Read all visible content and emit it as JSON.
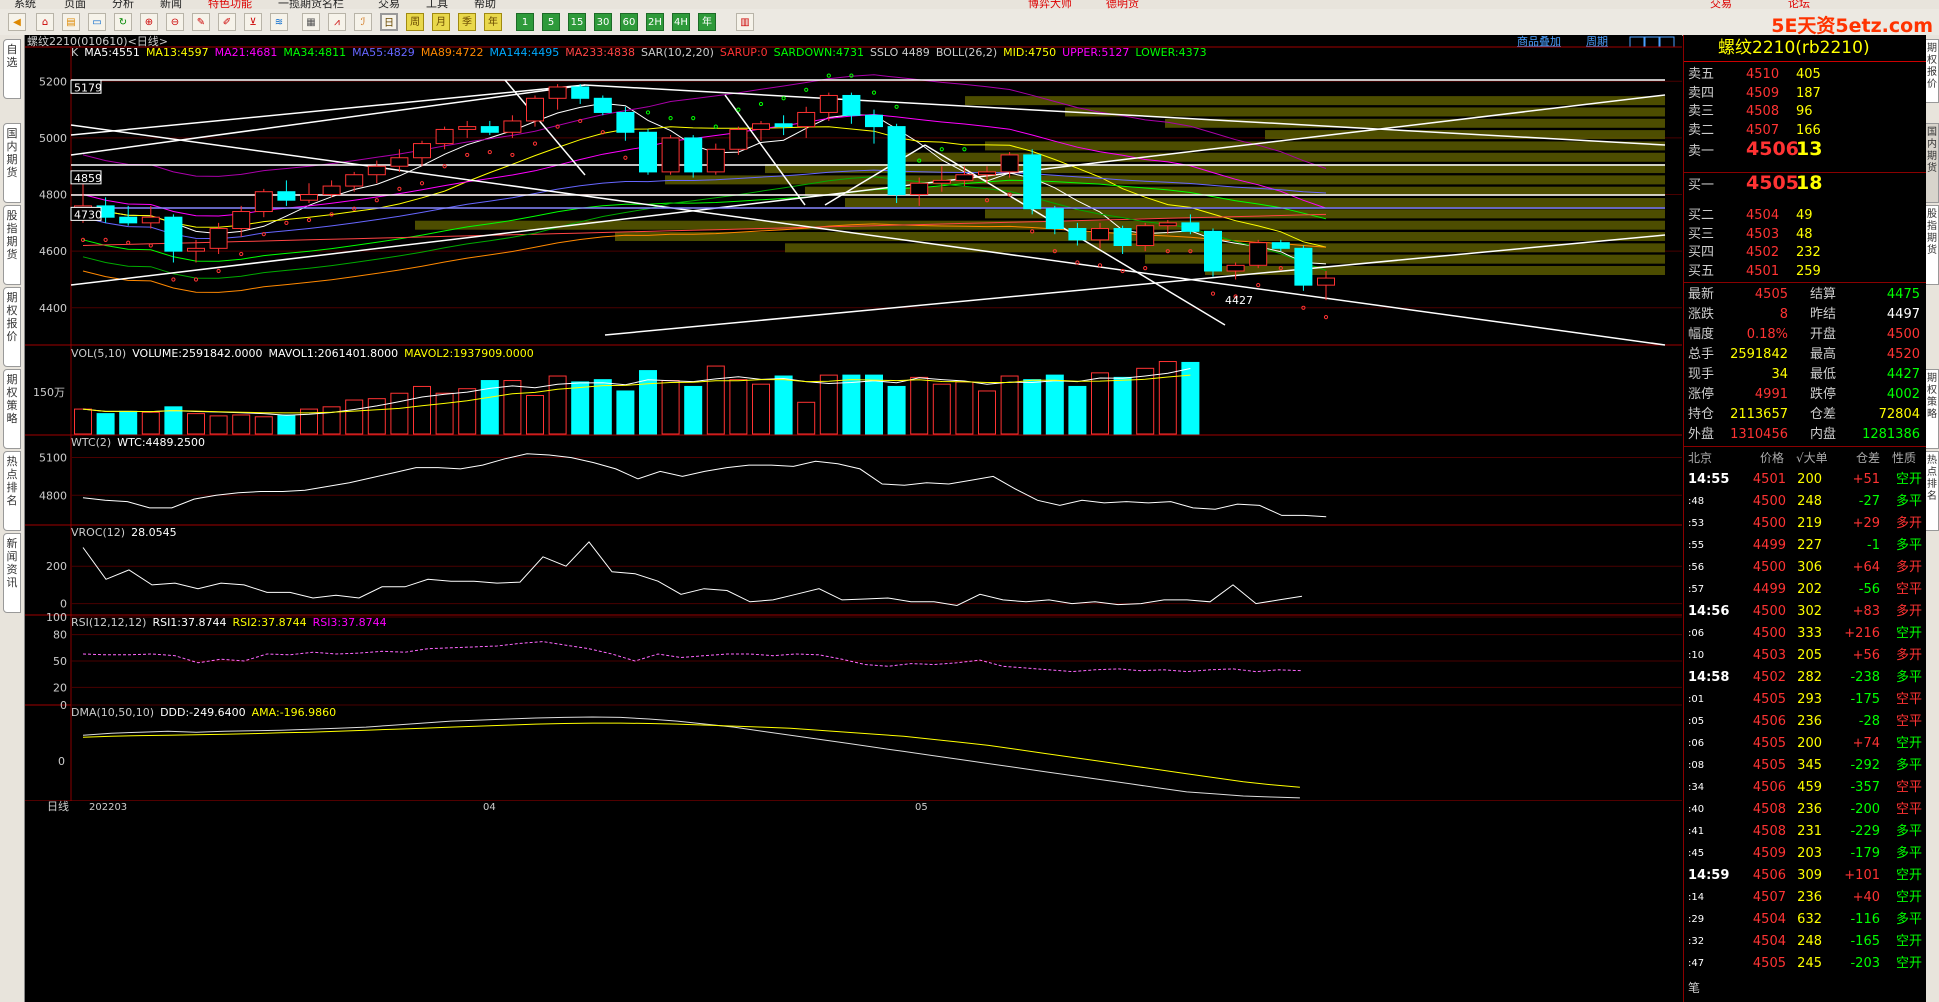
{
  "menu": [
    {
      "label": "系统"
    },
    {
      "label": "页面"
    },
    {
      "label": "分析"
    },
    {
      "label": "新闻"
    },
    {
      "label": "特色功能",
      "red": true
    },
    {
      "label": "一揽期货名栏"
    },
    {
      "label": "交易"
    },
    {
      "label": "工具"
    },
    {
      "label": "帮助"
    },
    {
      "label": "博弈大师",
      "red": true
    },
    {
      "label": "德明货",
      "red": true
    }
  ],
  "menu_right": [
    "交易",
    "论坛"
  ],
  "brand": "5E天资5etz.com",
  "toolbar": {
    "period_buttons": [
      "周",
      "月",
      "季",
      "年",
      "1",
      "5",
      "15",
      "30",
      "60",
      "2H",
      "4H",
      "年"
    ]
  },
  "left_tabs": [
    "自选",
    "国内期货",
    "股指期货",
    "期权报价",
    "期权策略",
    "热点排名",
    "新闻资讯"
  ],
  "right_tabs": [
    "期权报价",
    "国内期货",
    "股指期货",
    "期权策略",
    "热点排名"
  ],
  "chart": {
    "header": "螺纹2210(010610)<日线>",
    "overlay_btn": "商品叠加",
    "period_btn": "周期",
    "main_indicators": [
      {
        "t": "K",
        "c": "#cccccc"
      },
      {
        "t": "MA5:4551",
        "c": "#ffffff"
      },
      {
        "t": "MA13:4597",
        "c": "#ffff00"
      },
      {
        "t": "MA21:4681",
        "c": "#ff00ff"
      },
      {
        "t": "MA34:4811",
        "c": "#00ff00"
      },
      {
        "t": "MA55:4829",
        "c": "#6666ff"
      },
      {
        "t": "MA89:4722",
        "c": "#ff8800"
      },
      {
        "t": "MA144:4495",
        "c": "#00aaff"
      },
      {
        "t": "MA233:4838",
        "c": "#ff4444"
      },
      {
        "t": "SAR(10,2,20)",
        "c": "#cccccc"
      },
      {
        "t": "SARUP:0",
        "c": "#ff3333"
      },
      {
        "t": "SARDOWN:4731",
        "c": "#00ff00"
      },
      {
        "t": "SSLO 4489",
        "c": "#cccccc"
      },
      {
        "t": "BOLL(26,2)",
        "c": "#cccccc"
      },
      {
        "t": "MID:4750",
        "c": "#ffff00"
      },
      {
        "t": "UPPER:5127",
        "c": "#ff00ff"
      },
      {
        "t": "LOWER:4373",
        "c": "#00ff00"
      }
    ],
    "price_axis": [
      "5200",
      "5000",
      "4800",
      "4600",
      "4400"
    ],
    "price_boxes": [
      "5179",
      "4859",
      "4730"
    ],
    "low_label": "4427",
    "vol_indicators": [
      {
        "t": "VOL(5,10)",
        "c": "#cccccc"
      },
      {
        "t": "VOLUME:2591842.0000",
        "c": "#ffffff"
      },
      {
        "t": "MAVOL1:2061401.8000",
        "c": "#ffffff"
      },
      {
        "t": "MAVOL2:1937909.0000",
        "c": "#ffff00"
      }
    ],
    "vol_axis": "150万",
    "wtc_indicators": [
      {
        "t": "WTC(2)",
        "c": "#cccccc"
      },
      {
        "t": "WTC:4489.2500",
        "c": "#ffffff"
      }
    ],
    "wtc_axis": [
      "5100",
      "4800"
    ],
    "vroc_indicators": [
      {
        "t": "VROC(12)",
        "c": "#cccccc"
      },
      {
        "t": "28.0545",
        "c": "#ffffff"
      }
    ],
    "vroc_axis": [
      "200",
      "0"
    ],
    "rsi_indicators": [
      {
        "t": "RSI(12,12,12)",
        "c": "#cccccc"
      },
      {
        "t": "RSI1:37.8744",
        "c": "#ffffff"
      },
      {
        "t": "RSI2:37.8744",
        "c": "#ffff00"
      },
      {
        "t": "RSI3:37.8744",
        "c": "#ff00ff"
      }
    ],
    "rsi_axis": [
      "100",
      "80",
      "50",
      "20",
      "0"
    ],
    "dma_indicators": [
      {
        "t": "DMA(10,50,10)",
        "c": "#cccccc"
      },
      {
        "t": "DDD:-249.6400",
        "c": "#ffffff"
      },
      {
        "t": "AMA:-196.9860",
        "c": "#ffff00"
      }
    ],
    "dma_axis": "0",
    "period_label": "日线",
    "date_labels": [
      "202203",
      "04",
      "05"
    ]
  },
  "chart_data": {
    "type": "candlestick",
    "candles": [
      [
        4730,
        4850,
        4700,
        4760
      ],
      [
        4760,
        4790,
        4700,
        4720
      ],
      [
        4720,
        4760,
        4690,
        4700
      ],
      [
        4700,
        4760,
        4680,
        4720
      ],
      [
        4720,
        4730,
        4560,
        4600
      ],
      [
        4600,
        4640,
        4560,
        4610
      ],
      [
        4610,
        4700,
        4590,
        4680
      ],
      [
        4680,
        4760,
        4650,
        4740
      ],
      [
        4740,
        4820,
        4720,
        4810
      ],
      [
        4810,
        4850,
        4760,
        4780
      ],
      [
        4780,
        4840,
        4770,
        4800
      ],
      [
        4800,
        4850,
        4790,
        4830
      ],
      [
        4830,
        4880,
        4810,
        4870
      ],
      [
        4870,
        4920,
        4840,
        4900
      ],
      [
        4900,
        4960,
        4880,
        4930
      ],
      [
        4930,
        4990,
        4900,
        4980
      ],
      [
        4980,
        5040,
        4960,
        5030
      ],
      [
        5030,
        5060,
        5000,
        5040
      ],
      [
        5040,
        5060,
        5010,
        5020
      ],
      [
        5020,
        5080,
        5000,
        5060
      ],
      [
        5060,
        5150,
        5040,
        5140
      ],
      [
        5140,
        5190,
        5100,
        5180
      ],
      [
        5180,
        5190,
        5120,
        5140
      ],
      [
        5140,
        5150,
        5080,
        5090
      ],
      [
        5090,
        5110,
        4990,
        5020
      ],
      [
        5020,
        5030,
        4870,
        4880
      ],
      [
        4880,
        5010,
        4870,
        5000
      ],
      [
        5000,
        5010,
        4860,
        4880
      ],
      [
        4880,
        4980,
        4870,
        4960
      ],
      [
        4960,
        5040,
        4940,
        5030
      ],
      [
        5030,
        5060,
        4990,
        5050
      ],
      [
        5050,
        5080,
        5010,
        5040
      ],
      [
        5040,
        5110,
        5000,
        5090
      ],
      [
        5090,
        5160,
        5060,
        5150
      ],
      [
        5150,
        5160,
        5050,
        5080
      ],
      [
        5080,
        5100,
        4980,
        5040
      ],
      [
        5040,
        5050,
        4770,
        4800
      ],
      [
        4800,
        4860,
        4760,
        4840
      ],
      [
        4840,
        4900,
        4810,
        4850
      ],
      [
        4850,
        4900,
        4830,
        4870
      ],
      [
        4870,
        4900,
        4840,
        4880
      ],
      [
        4880,
        4950,
        4860,
        4940
      ],
      [
        4940,
        4960,
        4730,
        4750
      ],
      [
        4750,
        4760,
        4660,
        4680
      ],
      [
        4680,
        4700,
        4620,
        4640
      ],
      [
        4640,
        4700,
        4610,
        4680
      ],
      [
        4680,
        4690,
        4590,
        4620
      ],
      [
        4620,
        4700,
        4600,
        4690
      ],
      [
        4690,
        4710,
        4660,
        4700
      ],
      [
        4700,
        4730,
        4660,
        4670
      ],
      [
        4670,
        4680,
        4510,
        4530
      ],
      [
        4530,
        4560,
        4500,
        4550
      ],
      [
        4550,
        4640,
        4540,
        4630
      ],
      [
        4630,
        4640,
        4600,
        4610
      ],
      [
        4610,
        4620,
        4460,
        4480
      ],
      [
        4480,
        4530,
        4427,
        4505
      ]
    ],
    "volume": [
      0.55,
      0.45,
      0.5,
      0.48,
      0.6,
      0.45,
      0.4,
      0.42,
      0.38,
      0.42,
      0.55,
      0.6,
      0.75,
      0.78,
      0.9,
      1.05,
      0.9,
      1.0,
      1.18,
      1.18,
      0.85,
      1.28,
      1.15,
      1.2,
      0.95,
      1.4,
      1.18,
      1.05,
      1.5,
      1.2,
      1.1,
      1.28,
      0.7,
      1.3,
      1.3,
      1.3,
      1.05,
      1.25,
      1.1,
      1.15,
      0.95,
      1.28,
      1.2,
      1.3,
      1.05,
      1.35,
      1.25,
      1.45,
      1.6,
      1.58
    ],
    "wtc": [
      4780,
      4760,
      4750,
      4700,
      4700,
      4770,
      4800,
      4820,
      4830,
      4830,
      4840,
      4870,
      4900,
      4940,
      4980,
      5020,
      5020,
      5010,
      5040,
      5090,
      5130,
      5120,
      5100,
      5060,
      5010,
      4930,
      4990,
      4950,
      4990,
      5020,
      5040,
      5040,
      5030,
      5070,
      5050,
      5010,
      4890,
      4880,
      4900,
      4890,
      4920,
      4950,
      4850,
      4760,
      4720,
      4760,
      4740,
      4750,
      4740,
      4750,
      4700,
      4690,
      4730,
      4720,
      4640,
      4640,
      4630
    ],
    "vroc": [
      300,
      130,
      180,
      100,
      110,
      80,
      110,
      100,
      60,
      60,
      30,
      45,
      30,
      90,
      90,
      130,
      120,
      120,
      110,
      115,
      250,
      200,
      330,
      170,
      160,
      120,
      50,
      80,
      70,
      10,
      20,
      50,
      80,
      20,
      25,
      30,
      10,
      10,
      -10,
      50,
      20,
      10,
      20,
      0,
      10,
      -5,
      0,
      20,
      20,
      10,
      100,
      0,
      20,
      40
    ],
    "rsi": [
      58,
      57,
      57,
      58,
      56,
      48,
      52,
      50,
      58,
      57,
      60,
      58,
      59,
      61,
      60,
      64,
      65,
      66,
      67,
      70,
      72,
      68,
      64,
      58,
      50,
      58,
      54,
      56,
      58,
      58,
      56,
      58,
      57,
      52,
      46,
      44,
      47,
      46,
      48,
      51,
      44,
      42,
      40,
      38,
      40,
      41,
      39,
      40,
      38,
      40,
      41,
      38,
      40,
      39
    ],
    "ddd": [
      60,
      70,
      75,
      80,
      75,
      80,
      82,
      85,
      90,
      95,
      100,
      110,
      120,
      130,
      135,
      140,
      145,
      148,
      150,
      148,
      140,
      130,
      115,
      100,
      80,
      60,
      40,
      20,
      0,
      -20,
      -40,
      -60,
      -80,
      -100,
      -120,
      -140,
      -160,
      -180,
      -200,
      -220,
      -230,
      -240,
      -245,
      -249.64
    ],
    "ama": [
      50,
      55,
      58,
      60,
      62,
      65,
      68,
      72,
      75,
      80,
      85,
      90,
      95,
      100,
      105,
      110,
      115,
      118,
      120,
      120,
      118,
      115,
      110,
      105,
      100,
      95,
      85,
      75,
      65,
      55,
      40,
      25,
      10,
      -10,
      -30,
      -50,
      -70,
      -90,
      -110,
      -130,
      -150,
      -170,
      -185,
      -196.986
    ]
  },
  "quotes": {
    "title": "螺纹2210(rb2210)",
    "asks": [
      {
        "label": "卖五",
        "price": "4510",
        "vol": "405"
      },
      {
        "label": "卖四",
        "price": "4509",
        "vol": "187"
      },
      {
        "label": "卖三",
        "price": "4508",
        "vol": "96"
      },
      {
        "label": "卖二",
        "price": "4507",
        "vol": "166"
      }
    ],
    "ask1": {
      "label": "卖一",
      "price": "4506",
      "vol": "13"
    },
    "bid1": {
      "label": "买一",
      "price": "4505",
      "vol": "18"
    },
    "bids": [
      {
        "label": "买二",
        "price": "4504",
        "vol": "49"
      },
      {
        "label": "买三",
        "price": "4503",
        "vol": "48"
      },
      {
        "label": "买四",
        "price": "4502",
        "vol": "232"
      },
      {
        "label": "买五",
        "price": "4501",
        "vol": "259"
      }
    ],
    "stats": [
      {
        "l1": "最新",
        "v1": "4505",
        "c1": "#ff3333",
        "l2": "结算",
        "v2": "4475",
        "c2": "#00ff00"
      },
      {
        "l1": "涨跌",
        "v1": "8",
        "c1": "#ff3333",
        "l2": "昨结",
        "v2": "4497",
        "c2": "#ffffff"
      },
      {
        "l1": "幅度",
        "v1": "0.18%",
        "c1": "#ff3333",
        "l2": "开盘",
        "v2": "4500",
        "c2": "#ff3333"
      },
      {
        "l1": "总手",
        "v1": "2591842",
        "c1": "#ffff00",
        "l2": "最高",
        "v2": "4520",
        "c2": "#ff3333"
      },
      {
        "l1": "现手",
        "v1": "34",
        "c1": "#ffff00",
        "l2": "最低",
        "v2": "4427",
        "c2": "#00ff00"
      },
      {
        "l1": "涨停",
        "v1": "4991",
        "c1": "#ff3333",
        "l2": "跌停",
        "v2": "4002",
        "c2": "#00ff00"
      },
      {
        "l1": "持仓",
        "v1": "2113657",
        "c1": "#ffff00",
        "l2": "仓差",
        "v2": "72804",
        "c2": "#ffff00"
      },
      {
        "l1": "外盘",
        "v1": "1310456",
        "c1": "#ff3333",
        "l2": "内盘",
        "v2": "1281386",
        "c2": "#00ff00"
      }
    ],
    "tick_header": [
      "北京",
      "价格",
      "√大单",
      "仓差",
      "性质"
    ],
    "ticks": [
      {
        "t": "14:55",
        "p": "4501",
        "v": "200",
        "d": "+51",
        "n": "空开",
        "big": true
      },
      {
        "t": ":48",
        "p": "4500",
        "v": "248",
        "d": "-27",
        "n": "多平"
      },
      {
        "t": ":53",
        "p": "4500",
        "v": "219",
        "d": "+29",
        "n": "多开"
      },
      {
        "t": ":55",
        "p": "4499",
        "v": "227",
        "d": "-1",
        "n": "多平"
      },
      {
        "t": ":56",
        "p": "4500",
        "v": "306",
        "d": "+64",
        "n": "多开"
      },
      {
        "t": ":57",
        "p": "4499",
        "v": "202",
        "d": "-56",
        "n": "空平"
      },
      {
        "t": "14:56",
        "p": "4500",
        "v": "302",
        "d": "+83",
        "n": "多开",
        "big": true
      },
      {
        "t": ":06",
        "p": "4500",
        "v": "333",
        "d": "+216",
        "n": "空开"
      },
      {
        "t": ":10",
        "p": "4503",
        "v": "205",
        "d": "+56",
        "n": "多开"
      },
      {
        "t": "14:58",
        "p": "4502",
        "v": "282",
        "d": "-238",
        "n": "多平",
        "big": true
      },
      {
        "t": ":01",
        "p": "4505",
        "v": "293",
        "d": "-175",
        "n": "空平"
      },
      {
        "t": ":05",
        "p": "4506",
        "v": "236",
        "d": "-28",
        "n": "空平"
      },
      {
        "t": ":06",
        "p": "4505",
        "v": "200",
        "d": "+74",
        "n": "空开"
      },
      {
        "t": ":08",
        "p": "4505",
        "v": "345",
        "d": "-292",
        "n": "多平"
      },
      {
        "t": ":34",
        "p": "4506",
        "v": "459",
        "d": "-357",
        "n": "空平"
      },
      {
        "t": ":40",
        "p": "4508",
        "v": "236",
        "d": "-200",
        "n": "空平"
      },
      {
        "t": ":41",
        "p": "4508",
        "v": "231",
        "d": "-229",
        "n": "多平"
      },
      {
        "t": ":45",
        "p": "4509",
        "v": "203",
        "d": "-179",
        "n": "多平"
      },
      {
        "t": "14:59",
        "p": "4506",
        "v": "309",
        "d": "+101",
        "n": "空开",
        "big": true
      },
      {
        "t": ":14",
        "p": "4507",
        "v": "236",
        "d": "+40",
        "n": "空开"
      },
      {
        "t": ":29",
        "p": "4504",
        "v": "632",
        "d": "-116",
        "n": "多平"
      },
      {
        "t": ":32",
        "p": "4504",
        "v": "248",
        "d": "-165",
        "n": "空开"
      },
      {
        "t": ":47",
        "p": "4505",
        "v": "245",
        "d": "-203",
        "n": "空开"
      }
    ],
    "footer": "笔"
  }
}
